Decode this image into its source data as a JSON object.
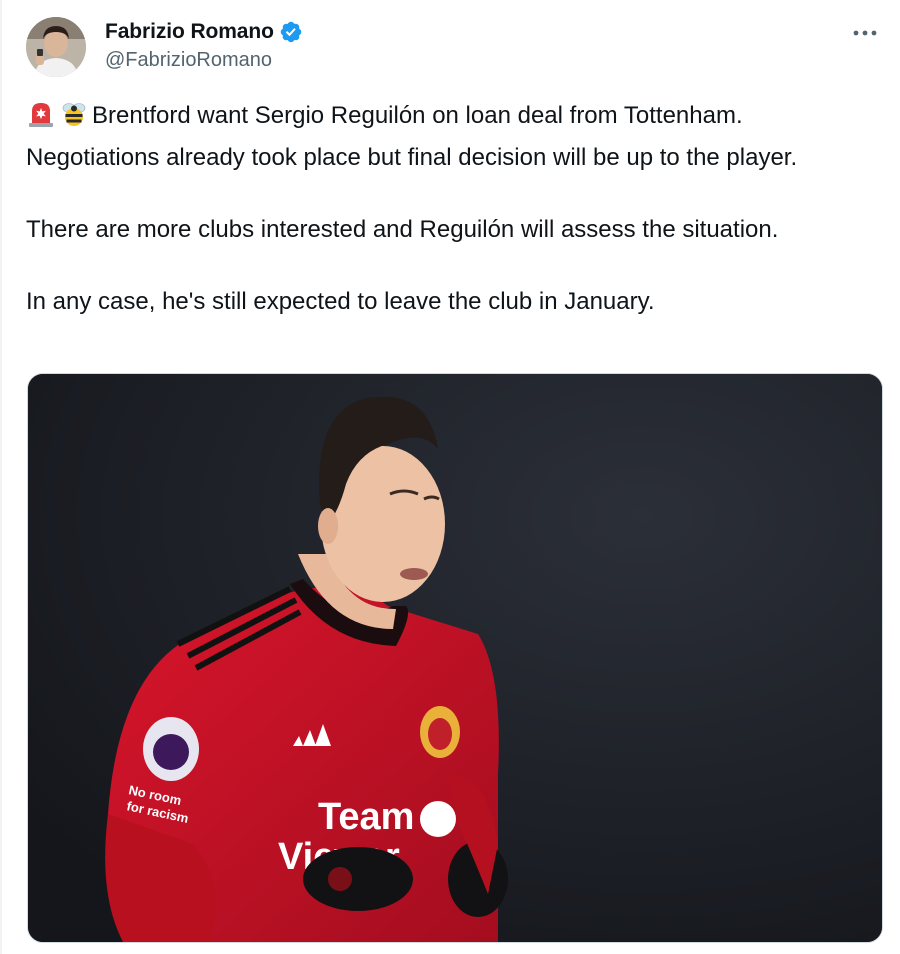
{
  "author": {
    "display_name": "Fabrizio Romano",
    "handle": "@FabrizioRomano",
    "verified": true,
    "avatar_icon": "profile-photo",
    "verified_color": "#1d9bf0"
  },
  "menu": {
    "icon": "more-horizontal-icon"
  },
  "tweet": {
    "emojis": [
      "rotating-light-emoji",
      "bee-emoji"
    ],
    "paragraphs": [
      "Brentford want Sergio Reguilón on loan deal from Tottenham. Negotiations already took place but final decision will be up to the player.",
      "There are more clubs interested and Reguilón will assess the situation.",
      "In any case, he's still expected to leave the club in January."
    ]
  },
  "media": {
    "description_icon": "photo-footballer-red-kit",
    "shirt_sponsor": "TeamViewer",
    "sleeve_text": "No room for racism",
    "kit_color": "#c8102e",
    "background_color": "#1a1d24"
  }
}
